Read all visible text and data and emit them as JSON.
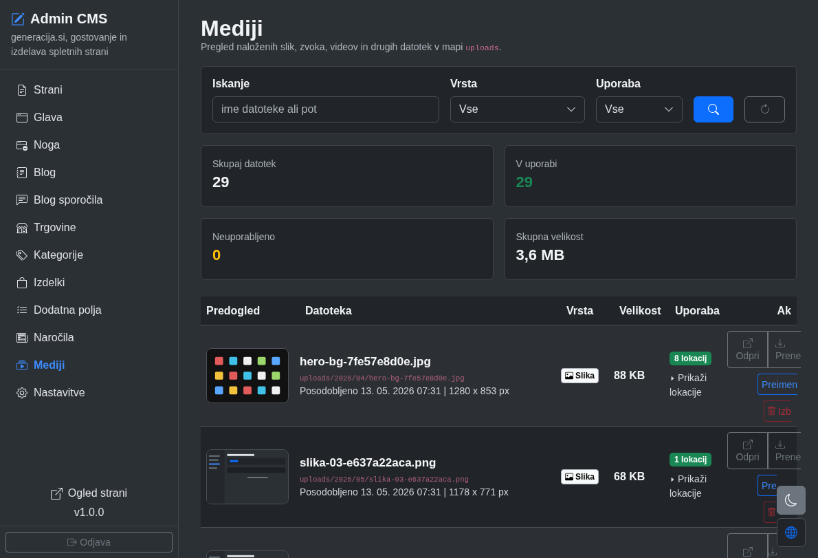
{
  "sidebar": {
    "brand": {
      "title": "Admin CMS",
      "subtitle": "generacija.si, gostovanje in izdelava spletnih strani"
    },
    "items": [
      {
        "label": "Strani",
        "selected": false
      },
      {
        "label": "Glava",
        "selected": false
      },
      {
        "label": "Noga",
        "selected": false
      },
      {
        "label": "Blog",
        "selected": false
      },
      {
        "label": "Blog sporočila",
        "selected": false
      },
      {
        "label": "Trgovine",
        "selected": false
      },
      {
        "label": "Kategorije",
        "selected": false
      },
      {
        "label": "Izdelki",
        "selected": false
      },
      {
        "label": "Dodatna polja",
        "selected": false
      },
      {
        "label": "Naročila",
        "selected": false
      },
      {
        "label": "Mediji",
        "selected": true
      },
      {
        "label": "Nastavitve",
        "selected": false
      }
    ],
    "view_site": "Ogled strani",
    "version": "v1.0.0",
    "logout": {
      "label": "Odjava",
      "disabled": true
    }
  },
  "page": {
    "title": "Mediji",
    "description": "Pregled naloženih slik, zvoka, videov in drugih datotek v mapi",
    "folder": "uploads",
    "description_end": "."
  },
  "filters": {
    "search": {
      "label": "Iskanje",
      "placeholder": "ime datoteke ali pot"
    },
    "type": {
      "label": "Vrsta",
      "value": "Vse"
    },
    "usage": {
      "label": "Uporaba",
      "value": "Vse"
    }
  },
  "stats": [
    {
      "label": "Skupaj datotek",
      "value": "29",
      "color": "#f1f3f5"
    },
    {
      "label": "V uporabi",
      "value": "29",
      "color": "#198754"
    },
    {
      "label": "Neuporabljeno",
      "value": "0",
      "color": "#ffc107"
    },
    {
      "label": "Skupna velikost",
      "value": "3,6 MB",
      "color": "#f1f3f5"
    }
  ],
  "table": {
    "columns": [
      "Predogled",
      "Datoteka",
      "Vrsta",
      "Velikost",
      "Uporaba",
      "Ak"
    ],
    "rows": [
      {
        "kind": "full",
        "name": "hero-bg-7fe57e8d0e.jpg",
        "path": "uploads/2026/04/hero-bg-7fe57e8d0e.jpg",
        "meta": "Posodobljeno 13. 05. 2026 07:31 | 1280 x 853 px",
        "type": "Slika",
        "size": "88 KB",
        "usage_badge": "8 lokacij",
        "usage_toggle": "Prikaži lokacije",
        "expanded": false,
        "actions": {
          "open": "Odpri",
          "download": "Prene",
          "rename": "Preimen",
          "delete": "Izb"
        }
      },
      {
        "kind": "full",
        "name": "slika-03-e637a22aca.png",
        "path": "uploads/2026/05/slika-03-e637a22aca.png",
        "meta": "Posodobljeno 13. 05. 2026 07:31 | 1178 x 771 px",
        "type": "Slika",
        "size": "68 KB",
        "usage_badge": "1 lokacij",
        "usage_toggle": "Prikaži lokacije",
        "expanded": false,
        "actions": {
          "open": "Odpri",
          "download": "Prene",
          "rename": "Pre"
        }
      },
      {
        "kind": "partial"
      }
    ]
  }
}
